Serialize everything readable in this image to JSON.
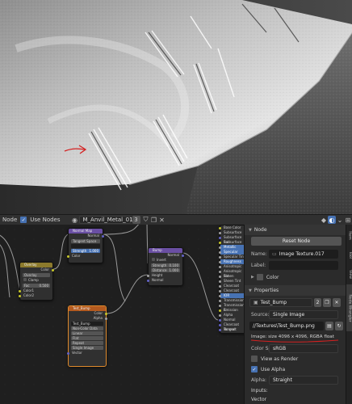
{
  "header": {
    "partial_label": "Node",
    "use_nodes_label": "Use Nodes",
    "material_name": "M_Anvil_Metal_01",
    "user_count": "3"
  },
  "nodes": {
    "principled": {
      "inputs": [
        "Base Color",
        "Subsurface",
        "Subsurface Rad.",
        "Subsurface Col.",
        "Metallic",
        "Specular",
        "Specular Tint",
        "Roughness",
        "Anisotropic",
        "Anisotropic Rot.",
        "Sheen",
        "Sheen Tint",
        "Clearcoat",
        "Clearcoat Rough.",
        "IOR",
        "Transmission",
        "Transmission R.",
        "Emission",
        "Alpha",
        "Normal",
        "Clearcoat Normal",
        "Tangent"
      ]
    },
    "normal_map": {
      "title": "Normal Map",
      "output": "Normal",
      "space": "Tangent Space",
      "uv": "",
      "strength_label": "Strength",
      "strength_value": "1.000",
      "color_label": "Color"
    },
    "bump": {
      "title": "Bump",
      "output": "Normal",
      "invert": "Invert",
      "strength_label": "Strength",
      "strength_value": "0.100",
      "distance_label": "Distance",
      "distance_value": "1.000",
      "height": "Height",
      "normal_in": "Normal"
    },
    "overlay": {
      "title": "Overlay",
      "output": "Color",
      "mode": "Overlay",
      "clamp": "Clamp",
      "fac_label": "Fac",
      "fac_value": "0.500",
      "color1": "Color1",
      "color2": "Color2"
    },
    "image_texture": {
      "title": "Test_Bump",
      "out_color": "Color",
      "out_alpha": "Alpha",
      "image_name": "Test_Bump",
      "colorspace": "Non-Color Data",
      "interpolation": "Linear",
      "projection": "Flat",
      "extension": "Repeat",
      "source": "Single Image",
      "vector": "Vector"
    }
  },
  "panel": {
    "node_section": "Node",
    "reset_button": "Reset Node",
    "name_label": "Name:",
    "name_value": "Image Texture.017",
    "label_label": "Label:",
    "label_value": "",
    "color_label": "Color",
    "properties_section": "Properties",
    "image_name": "Test_Bump",
    "image_users": "2",
    "source_label": "Source:",
    "source_value": "Single Image",
    "filepath": "//Textures\\Test_Bump.png",
    "image_info": "Image: size 4096 x 4096, RGBA float",
    "color_space_label": "Color Sp...",
    "color_space_value": "sRGB",
    "view_as_render": "View as Render",
    "use_alpha": "Use Alpha",
    "alpha_label": "Alpha:",
    "alpha_value": "Straight",
    "inputs_label": "Inputs:",
    "vector_label": "Vector"
  },
  "tabs": [
    "Item",
    "Tool",
    "View",
    "Node Wrangler"
  ],
  "colors": {
    "accent": "#4772b3",
    "annotation_red": "#d42020",
    "panel_bg": "#2b2b2b",
    "node_canvas_bg": "#1f1f1f"
  }
}
